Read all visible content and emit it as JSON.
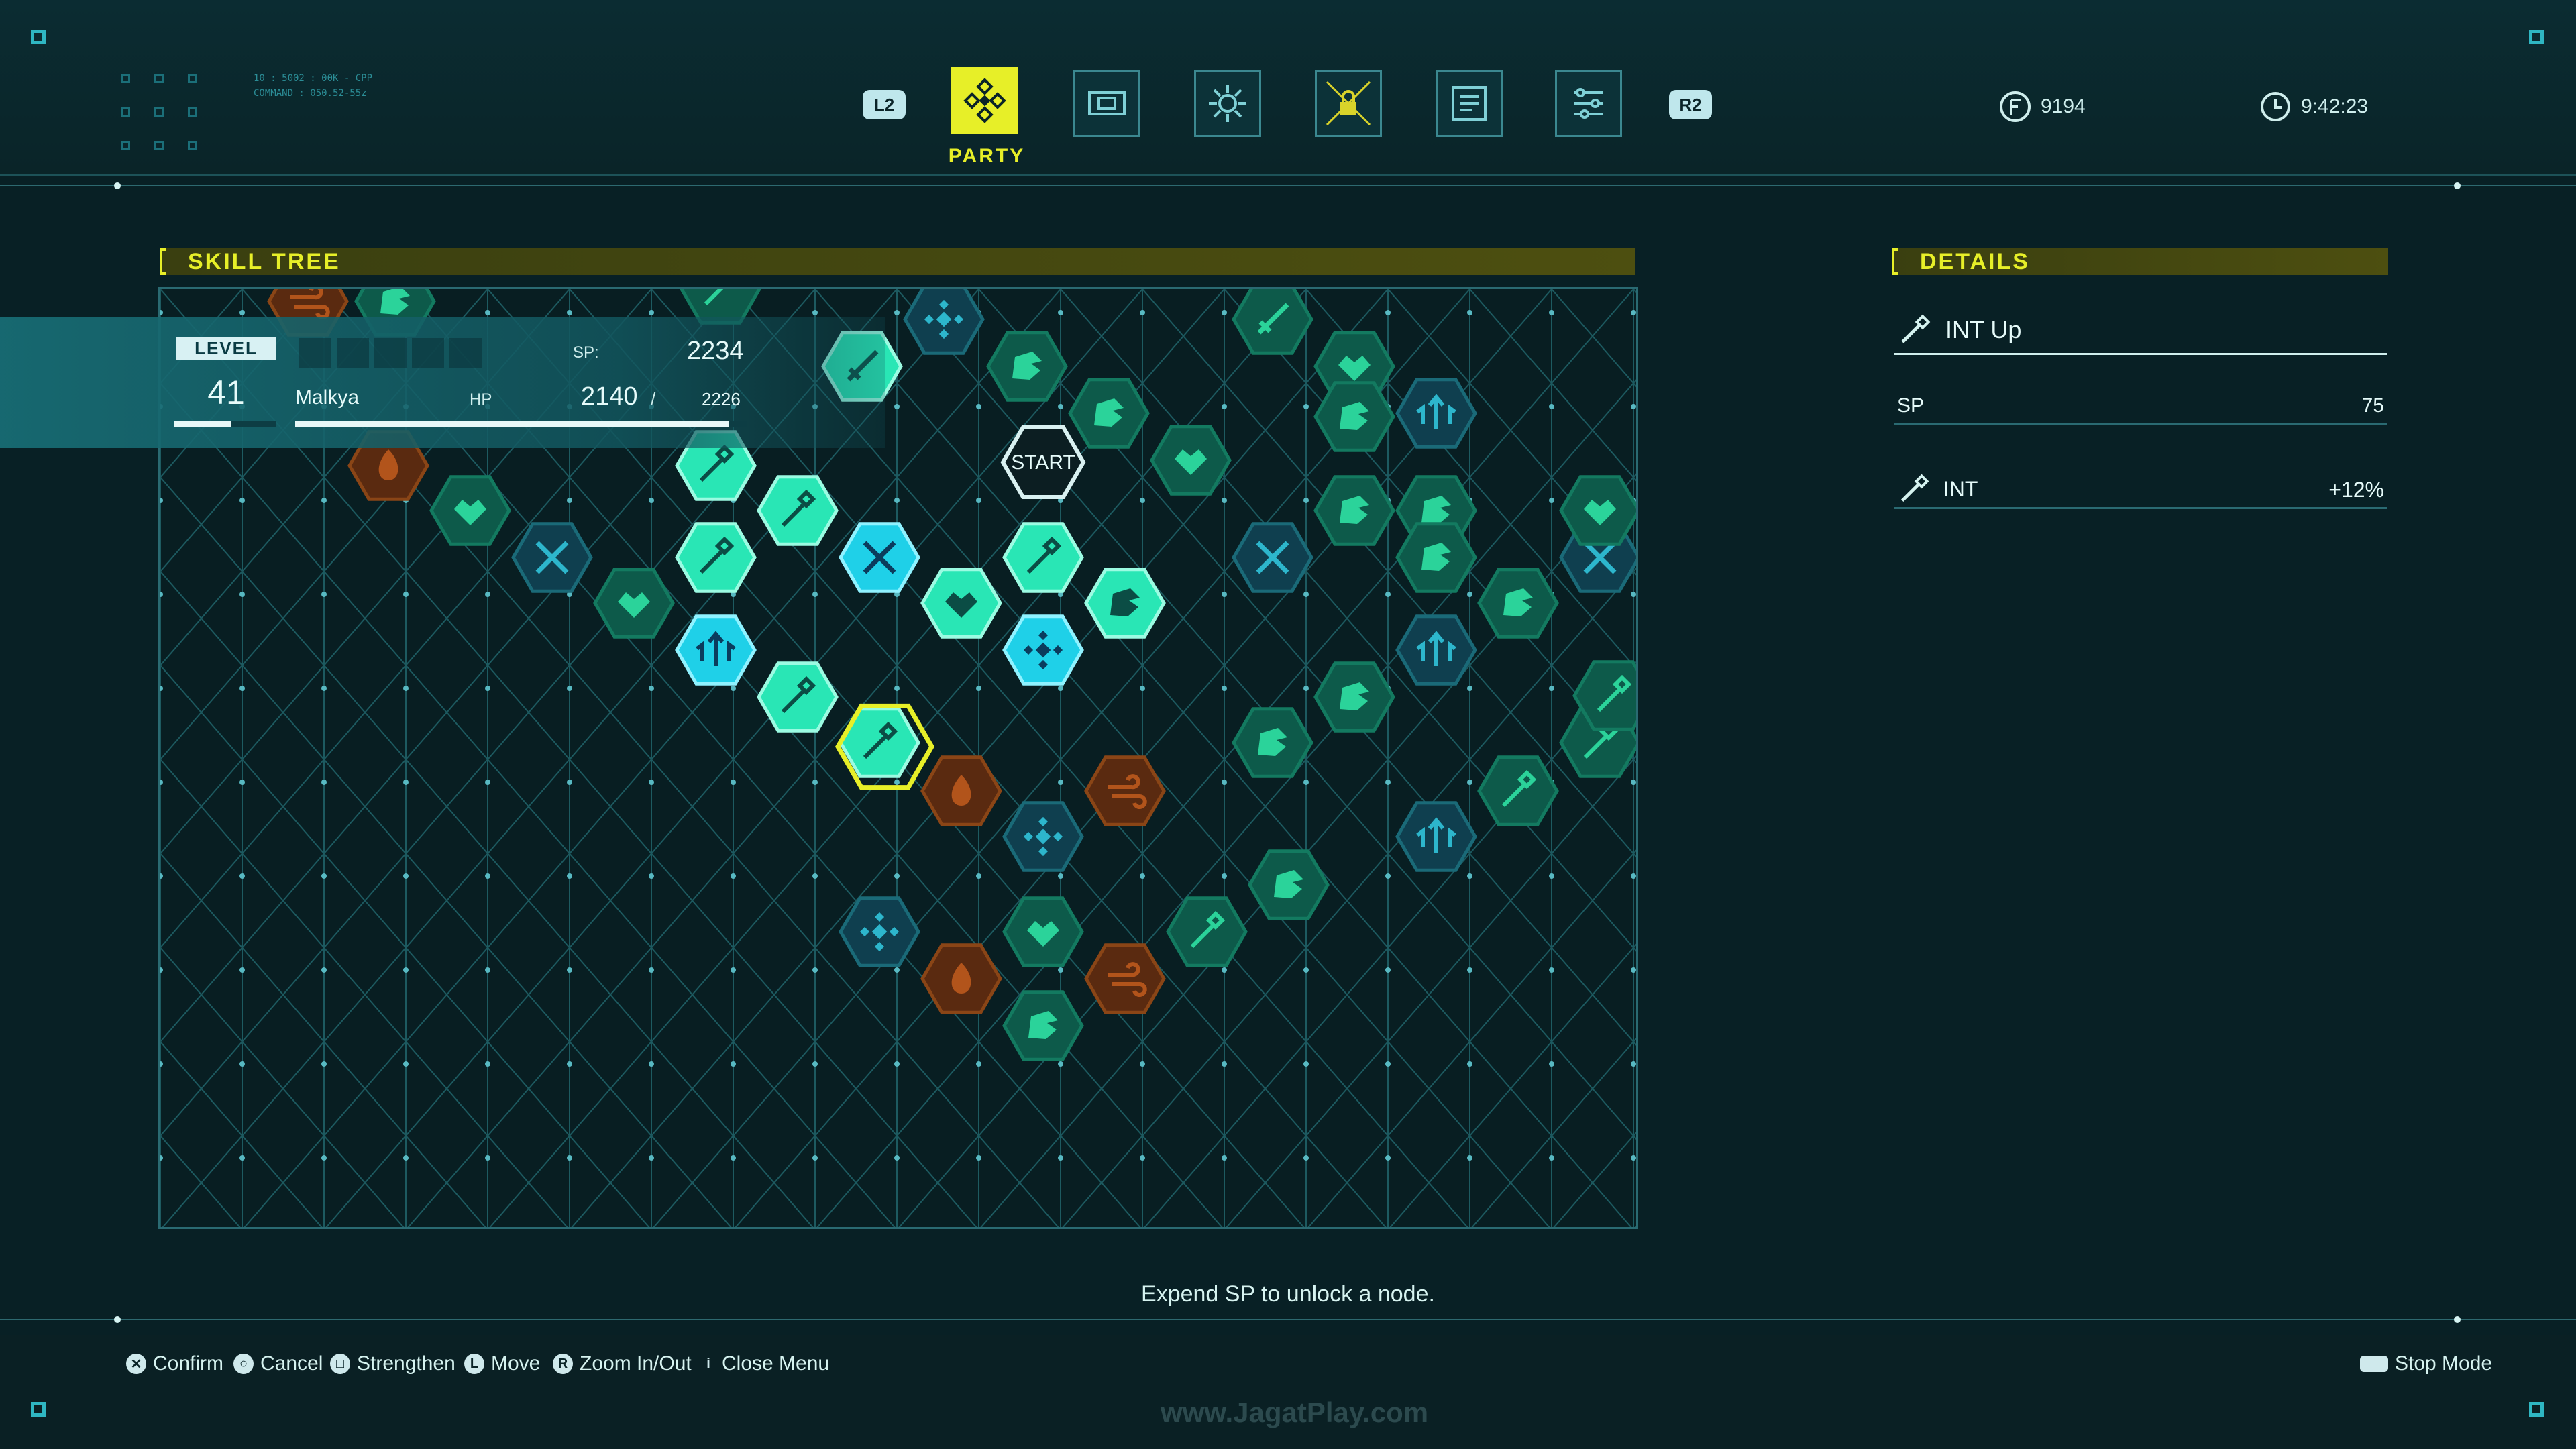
{
  "hud": {
    "code_line1": "10 : 5002 : 00K - CPP",
    "code_line2": "COMMAND : 050.52-55z",
    "tabs": [
      {
        "name": "party",
        "icon": "party-diamond-icon",
        "active": true
      },
      {
        "name": "equipment",
        "icon": "equipment-icon",
        "active": false
      },
      {
        "name": "skills",
        "icon": "skill-gear-icon",
        "active": false
      },
      {
        "name": "items",
        "icon": "lock-icon",
        "active": false
      },
      {
        "name": "archive",
        "icon": "document-icon",
        "active": false
      },
      {
        "name": "system",
        "icon": "settings-list-icon",
        "active": false
      }
    ],
    "shoulder_left": "L2",
    "shoulder_right": "R2",
    "active_tab_label": "PARTY",
    "currency": "9194",
    "playtime": "9:42:23"
  },
  "skill_tree": {
    "title": "SKILL TREE",
    "start_label": "START"
  },
  "character": {
    "level_label": "LEVEL",
    "level": "41",
    "name": "Malkya",
    "sp_label": "SP:",
    "sp": "2234",
    "hp_label": "HP",
    "hp": "2140",
    "hp_sep": "/",
    "hp_max": "2226",
    "level_progress": 0.55,
    "hp_fraction": 0.96
  },
  "details": {
    "title": "DETAILS",
    "node_name": "INT Up",
    "sp_label": "SP",
    "sp_cost": "75",
    "stat_label": "INT",
    "stat_value": "+12%"
  },
  "hint": "Expend SP to unlock a node.",
  "controls": [
    {
      "glyph": "✕",
      "label": "Confirm"
    },
    {
      "glyph": "○",
      "label": "Cancel"
    },
    {
      "glyph": "□",
      "label": "Strengthen"
    },
    {
      "glyph": "L",
      "label": "Move"
    },
    {
      "glyph": "R",
      "label": "Zoom In/Out"
    },
    {
      "glyph": "i",
      "label": "Close Menu"
    }
  ],
  "stop_mode": "Stop Mode",
  "watermark": "www.JagatPlay.com",
  "colors": {
    "accent": "#e7ef28",
    "unlocked": "#29e6b5",
    "special": "#1fd0e8",
    "locked": "#0d5a4a",
    "orange": "#b2541b"
  }
}
